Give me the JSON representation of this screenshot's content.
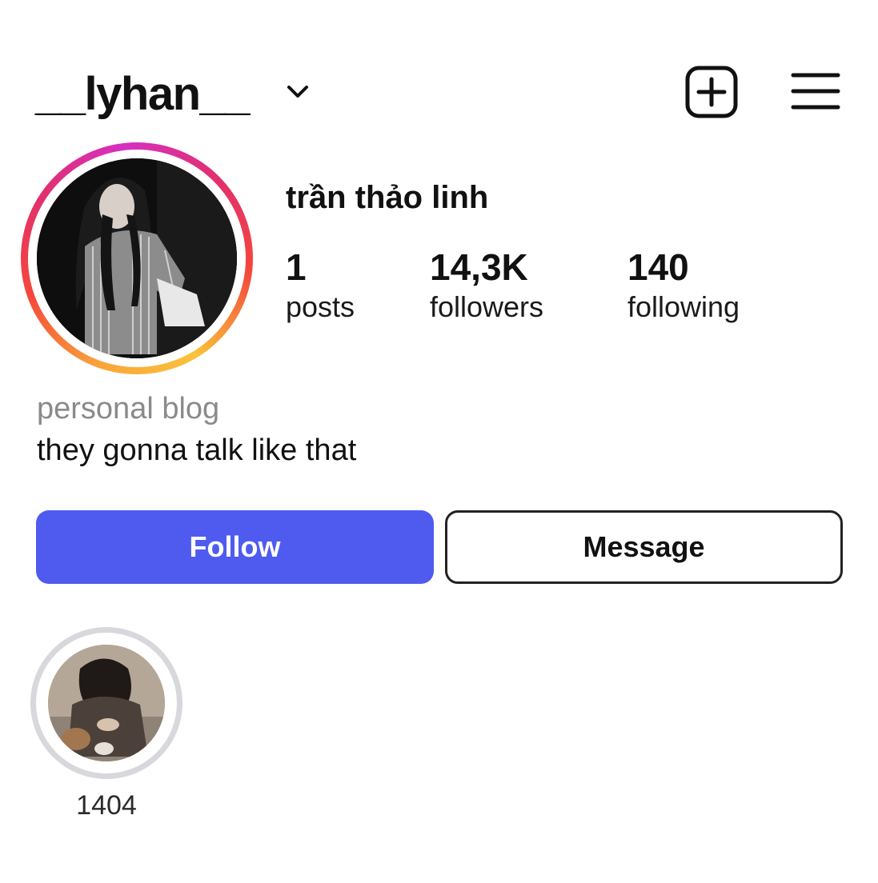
{
  "header": {
    "username": "__lyhan__",
    "dropdown_icon": "chevron-down-icon",
    "create_icon": "plus-square-icon",
    "menu_icon": "hamburger-menu-icon"
  },
  "profile": {
    "full_name": "trần thảo linh",
    "avatar_ring_colors": [
      "#f9a33a",
      "#f5473b",
      "#e1306c",
      "#d62fc2"
    ],
    "stats": [
      {
        "value": "1",
        "label": "posts"
      },
      {
        "value": "14,3K",
        "label": "followers"
      },
      {
        "value": "140",
        "label": "following"
      }
    ],
    "category": "personal blog",
    "bio": "they gonna talk like that"
  },
  "actions": {
    "follow_label": "Follow",
    "follow_color": "#4f5bef",
    "message_label": "Message"
  },
  "highlights": [
    {
      "label": "1404"
    }
  ]
}
